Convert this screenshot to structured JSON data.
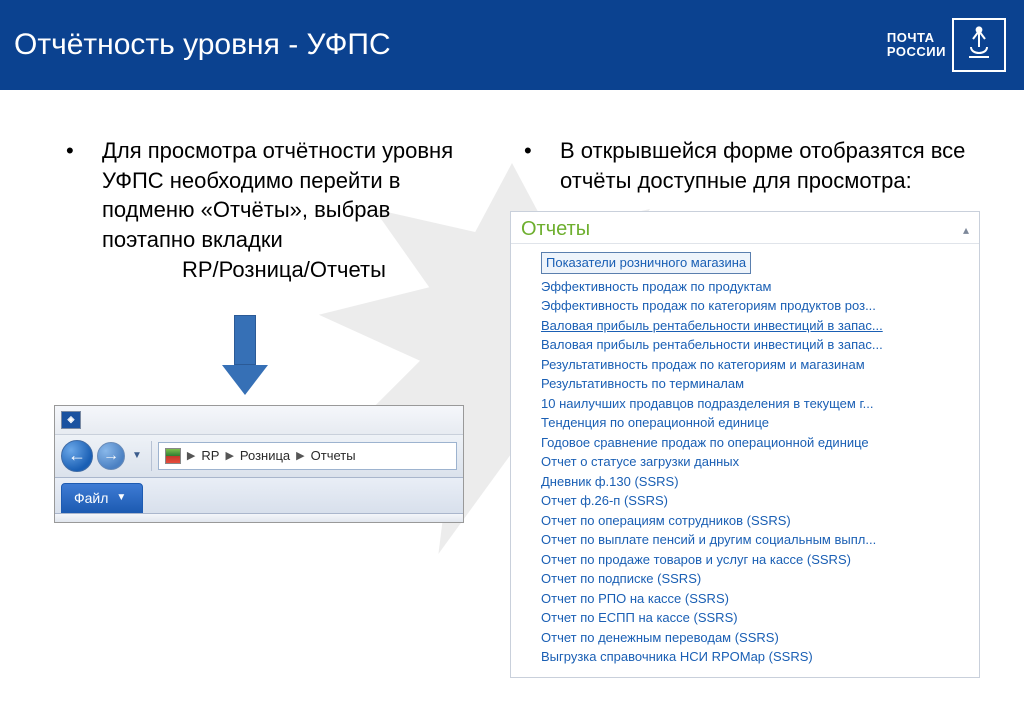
{
  "header": {
    "title": "Отчётность уровня   -  УФПС",
    "logo_line1": "ПОЧТА",
    "logo_line2": "РОССИИ"
  },
  "left": {
    "text": "Для просмотра отчётности уровня УФПС необходимо перейти в подменю «Отчёты», выбрав поэтапно вкладки",
    "path": "RP/Розница/Отчеты"
  },
  "right": {
    "text": "В открывшейся форме отобразятся все отчёты доступные для просмотра:"
  },
  "nav": {
    "bc1": "RP",
    "bc2": "Розница",
    "bc3": "Отчеты",
    "tab": "Файл"
  },
  "reports": {
    "title": "Отчеты",
    "items": [
      "Показатели розничного магазина",
      "Эффективность продаж по продуктам",
      "Эффективность продаж по категориям продуктов роз...",
      "Валовая прибыль рентабельности инвестиций в запас...",
      "Валовая прибыль рентабельности инвестиций в запас...",
      "Результативность продаж по категориям и магазинам",
      "Результативность по терминалам",
      "10 наилучших продавцов подразделения в текущем г...",
      "Тенденция по операционной единице",
      "Годовое сравнение продаж по операционной единице",
      "Отчет о статусе загрузки данных",
      "Дневник ф.130 (SSRS)",
      "Отчет ф.26-п (SSRS)",
      "Отчет по операциям сотрудников (SSRS)",
      "Отчет по выплате пенсий и другим социальным выпл...",
      "Отчет по продаже товаров и услуг на кассе (SSRS)",
      "Отчет по подписке (SSRS)",
      "Отчет по РПО на кассе (SSRS)",
      "Отчет по ЕСПП на кассе (SSRS)",
      "Отчет по денежным переводам (SSRS)",
      "Выгрузка справочника НСИ RPOMap (SSRS)"
    ]
  }
}
